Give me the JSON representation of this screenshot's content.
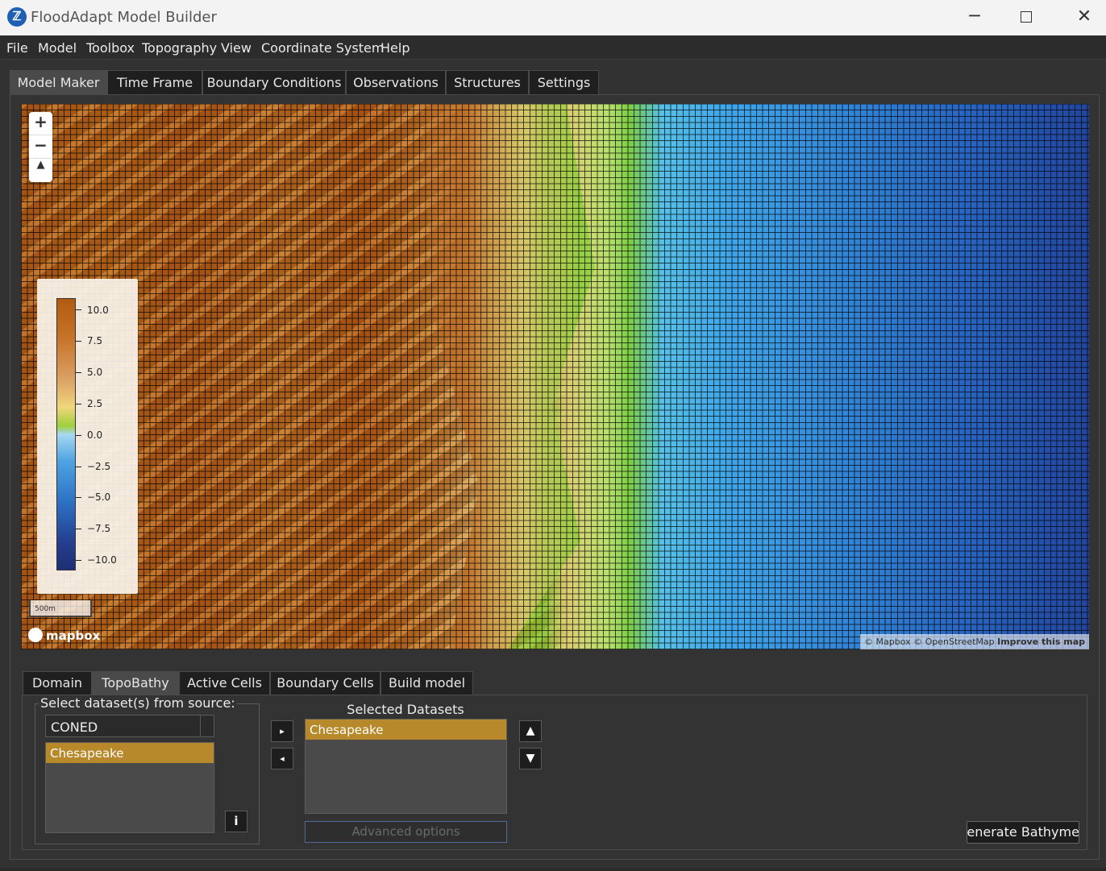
{
  "window": {
    "title": "FloodAdapt Model Builder",
    "app_icon": "floodadapt-logo",
    "controls": {
      "minimize": "─",
      "close": "✕"
    }
  },
  "menu": [
    "File",
    "Model",
    "Toolbox",
    "Topography",
    "View",
    "Coordinate System",
    "Help"
  ],
  "main_tabs": [
    "Model Maker",
    "Time Frame",
    "Boundary Conditions",
    "Observations",
    "Structures",
    "Settings"
  ],
  "active_main_tab": "Model Maker",
  "map": {
    "zoom_in": "+",
    "zoom_out": "−",
    "compass": "▲",
    "legend": {
      "colormap_top": "#b25a12",
      "colormap_bottom": "#1e2f74",
      "labels": [
        "10.0",
        "7.5",
        "5.0",
        "2.5",
        "0.0",
        "−2.5",
        "−5.0",
        "−7.5",
        "−10.0"
      ]
    },
    "scale_label": "500m",
    "logo": "mapbox",
    "attribution": "© Mapbox © OpenStreetMap",
    "attribution_link": "Improve this map"
  },
  "sub_tabs": [
    "Domain",
    "TopoBathy",
    "Active Cells",
    "Boundary Cells",
    "Build model"
  ],
  "active_sub_tab": "TopoBathy",
  "topobathy": {
    "group_title": "Select dataset(s) from source:",
    "source_value": "CONED",
    "available_datasets": [
      "Chesapeake"
    ],
    "info_label": "i",
    "add_label": "▸",
    "remove_label": "◂",
    "selected_title": "Selected Datasets",
    "selected_datasets": [
      "Chesapeake"
    ],
    "move_up_label": "▲",
    "move_down_label": "▼",
    "advanced_label": "Advanced options",
    "generate_label": "Generate Bathymetry"
  },
  "colors": {
    "selection": "#b7892a",
    "background": "#323232"
  }
}
